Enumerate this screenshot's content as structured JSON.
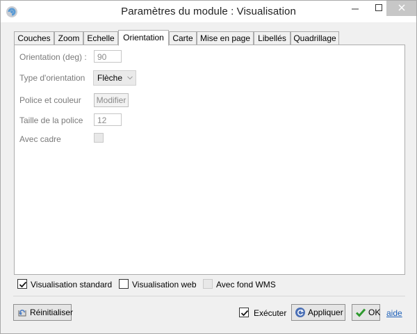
{
  "window": {
    "title": "Paramètres du module : Visualisation",
    "controls": {
      "minimize_icon": "minimize-icon",
      "maximize_icon": "maximize-icon",
      "close_icon": "close-icon"
    }
  },
  "tabs": [
    {
      "label": "Couches",
      "active": false
    },
    {
      "label": "Zoom",
      "active": false
    },
    {
      "label": "Echelle",
      "active": false
    },
    {
      "label": "Orientation",
      "active": true
    },
    {
      "label": "Carte",
      "active": false
    },
    {
      "label": "Mise en page",
      "active": false
    },
    {
      "label": "Libellés",
      "active": false
    },
    {
      "label": "Quadrillage",
      "active": false
    }
  ],
  "orientation": {
    "deg_label": "Orientation (deg) :",
    "deg_value": "90",
    "type_label": "Type d'orientation",
    "type_value": "Flèche",
    "font_label": "Police et couleur",
    "font_button": "Modifier",
    "size_label": "Taille de la police",
    "size_value": "12",
    "frame_label": "Avec cadre",
    "frame_checked": false
  },
  "options": {
    "standard_label": "Visualisation standard",
    "standard_checked": true,
    "web_label": "Visualisation web",
    "web_checked": false,
    "wms_label": "Avec fond WMS",
    "wms_checked": false
  },
  "footer": {
    "reset_label": "Réinitialiser",
    "execute_label": "Exécuter",
    "execute_checked": true,
    "apply_label": "Appliquer",
    "ok_label": "OK",
    "help_label": "aide"
  },
  "colors": {
    "accent_link": "#1b5fb8",
    "ok_green": "#2e9a2e",
    "panel_bg": "#ffffff",
    "window_bg": "#f0f0f0"
  }
}
